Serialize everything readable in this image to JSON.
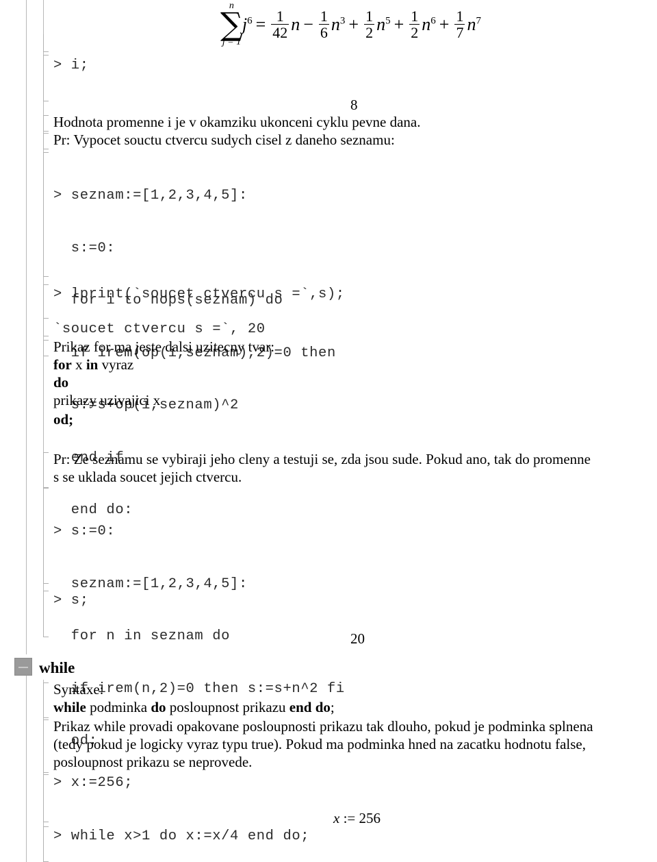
{
  "document": {
    "formula": {
      "sum_upper": "n",
      "sum_lower": "j = 1",
      "summand_base": "j",
      "summand_exp": "6",
      "equals": "=",
      "terms": [
        {
          "sign": "",
          "num": "1",
          "den": "42",
          "var": "n",
          "exp": ""
        },
        {
          "sign": "−",
          "num": "1",
          "den": "6",
          "var": "n",
          "exp": "3"
        },
        {
          "sign": "+",
          "num": "1",
          "den": "2",
          "var": "n",
          "exp": "5"
        },
        {
          "sign": "+",
          "num": "1",
          "den": "2",
          "var": "n",
          "exp": "6"
        },
        {
          "sign": "+",
          "num": "1",
          "den": "7",
          "var": "n",
          "exp": "7"
        }
      ]
    },
    "prompt_i": "> i;",
    "output_8": "8",
    "line_hodnota": "Hodnota promenne i je v okamziku ukonceni cyklu pevne dana.",
    "line_pr1": "Pr: Vypocet souctu ctvercu sudych cisel z daneho seznamu:",
    "code_block_1": [
      "> seznam:=[1,2,3,4,5]:",
      "  s:=0:",
      "  for i to nops(seznam) do",
      "  if irem(op(i,seznam),2)=0 then",
      "  s:=s+op(i,seznam)^2",
      "  end if",
      "  end do:"
    ],
    "prompt_lprint": "> lprint(`soucet ctvercu s =`,s);",
    "output_lprint": "`soucet ctvercu s =`, 20",
    "line_prikaz_for": "Prikaz for ma jeste dalsi uzitecny tvar:",
    "syntax_for": {
      "kw_for": "for",
      "x1": "x",
      "kw_in": "in",
      "vyraz": "vyraz",
      "kw_do": "do",
      "body": "prikazy uzivajici x",
      "kw_od": "od;"
    },
    "para_pr2_line1": "Pr: Ze seznamu se vybiraji jeho cleny a testuji se, zda jsou sude.   Pokud ano, tak do promenne",
    "para_pr2_line2": "s se uklada soucet jejich ctvercu.",
    "code_block_2": [
      "> s:=0:",
      "  seznam:=[1,2,3,4,5]:",
      "  for n in seznam do",
      "  if irem(n,2)=0 then s:=s+n^2 fi",
      "  od:"
    ],
    "prompt_s": "> s;",
    "output_20": "20",
    "section_while_title": "while",
    "syntaxe_label": "Syntaxe:",
    "syntax_while": {
      "kw_while": "while",
      "podminka": "podminka",
      "kw_do": "do",
      "posloupnost": "posloupnost prikazu",
      "kw_end_do": "end do",
      "semicolon": ";"
    },
    "para_while_line1": "Prikaz while provadi opakovane posloupnosti prikazu tak dlouho, pokud je podminka splnena",
    "para_while_line2": "(tedy pokud je logicky vyraz typu true). Pokud ma podminka hned na zacatku hodnotu false,",
    "para_while_line3": "posloupnost prikazu se neprovede.",
    "prompt_x256": "> x:=256;",
    "output_x256": {
      "lhs": "x",
      "assign": ":=",
      "rhs": "256"
    },
    "prompt_while_loop": "> while x>1 do x:=x/4 end do;"
  },
  "colors": {
    "rail": "#b8b8b8",
    "bracket": "#b0b0b0",
    "code_text": "#2b2b2b",
    "toggle_fill": "#9a9a9a",
    "toggle_minus": "#c8c8c8"
  }
}
